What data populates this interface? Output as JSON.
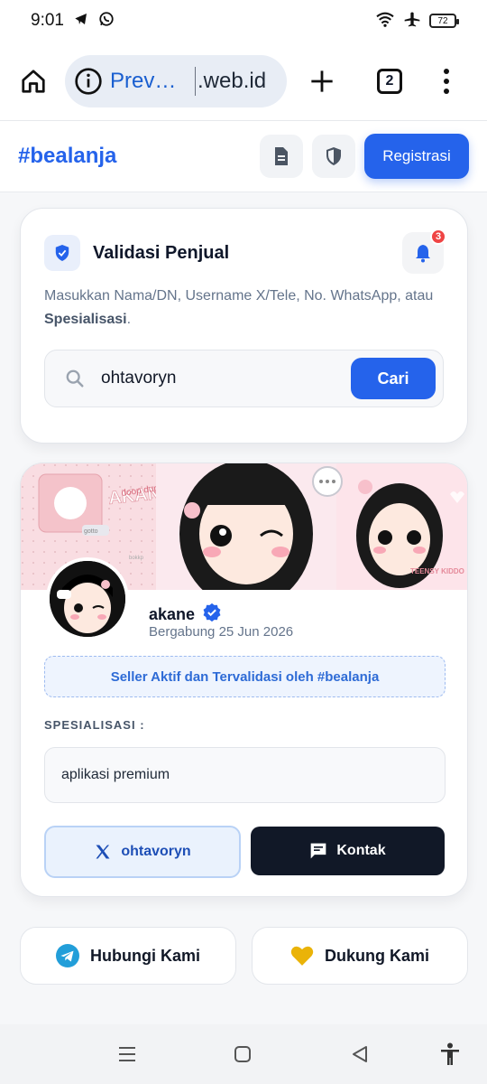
{
  "status_bar": {
    "time": "9:01",
    "battery": "72"
  },
  "browser": {
    "tab_title": "Prev…",
    "domain": ".web.id",
    "tab_count": "2"
  },
  "header": {
    "brand": "#bealanja",
    "register_label": "Registrasi"
  },
  "validation": {
    "title": "Validasi Penjual",
    "notification_count": "3",
    "description_prefix": "Masukkan Nama/DN, Username X/Tele, No. WhatsApp, atau ",
    "description_bold": "Spesialisasi",
    "description_suffix": ".",
    "search_value": "ohtavoryn",
    "search_button": "Cari"
  },
  "profile": {
    "name": "akane",
    "joined": "Bergabung 25 Jun 2026",
    "verified_note": "Seller Aktif dan Tervalidasi oleh #bealanja",
    "spec_label": "SPESIALISASI :",
    "specialization": "aplikasi premium",
    "x_handle": "ohtavoryn",
    "contact_label": "Kontak",
    "banner_text": {
      "title": "AKANE'S PAGE",
      "tagline": "doop dup",
      "badge": "TEENSY KIDDO",
      "sticker": "gotto",
      "watermark": "bokkp"
    }
  },
  "footer": {
    "contact_label": "Hubungi Kami",
    "support_label": "Dukung Kami"
  },
  "colors": {
    "primary": "#2563eb",
    "dark": "#111827",
    "telegram": "#229ed9",
    "heart": "#eab308"
  }
}
